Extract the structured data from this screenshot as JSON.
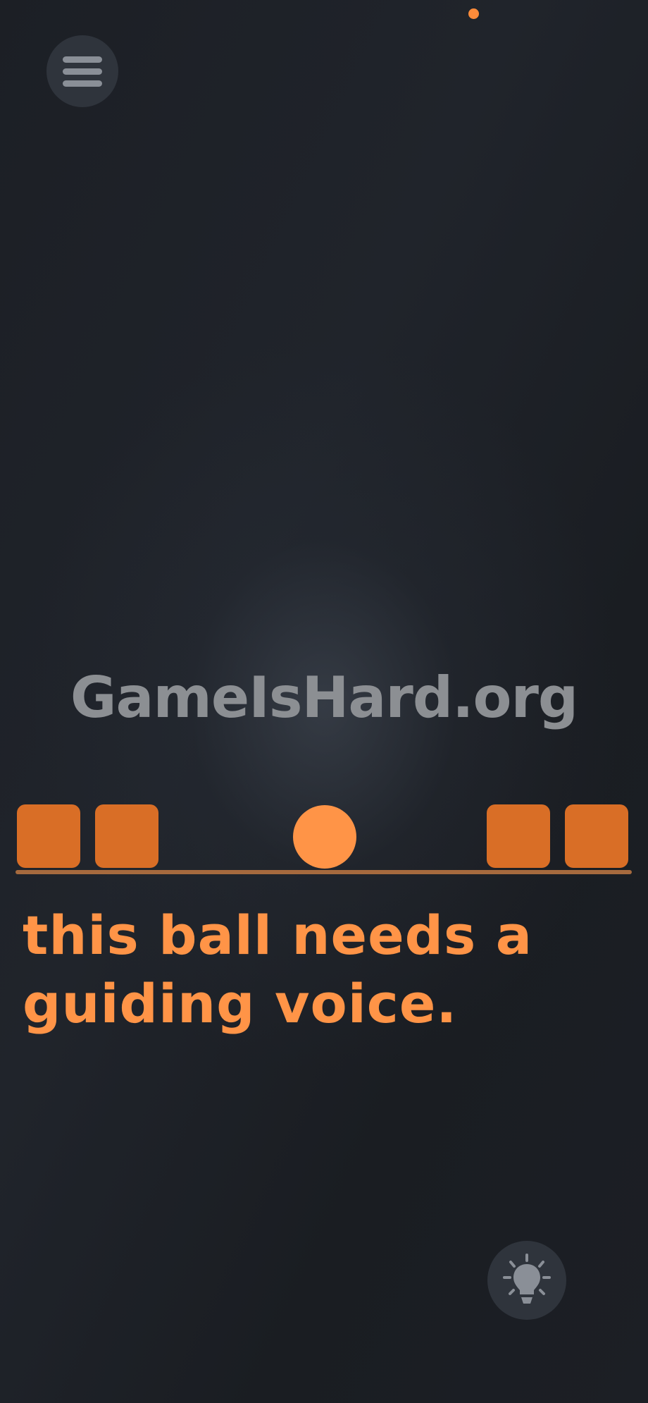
{
  "colors": {
    "accent": "#ff9447",
    "block": "#d96e26",
    "ground": "#a66a3e",
    "caption": "#ff9447",
    "watermark": "#8c8f93",
    "status_dot": "#ff8c3a"
  },
  "menu": {
    "icon": "hamburger-menu-icon"
  },
  "watermark": {
    "text": "GameIsHard.org"
  },
  "level": {
    "caption_line1": "this ball needs a",
    "caption_line2": "guiding voice."
  },
  "hint": {
    "icon": "lightbulb-icon"
  }
}
